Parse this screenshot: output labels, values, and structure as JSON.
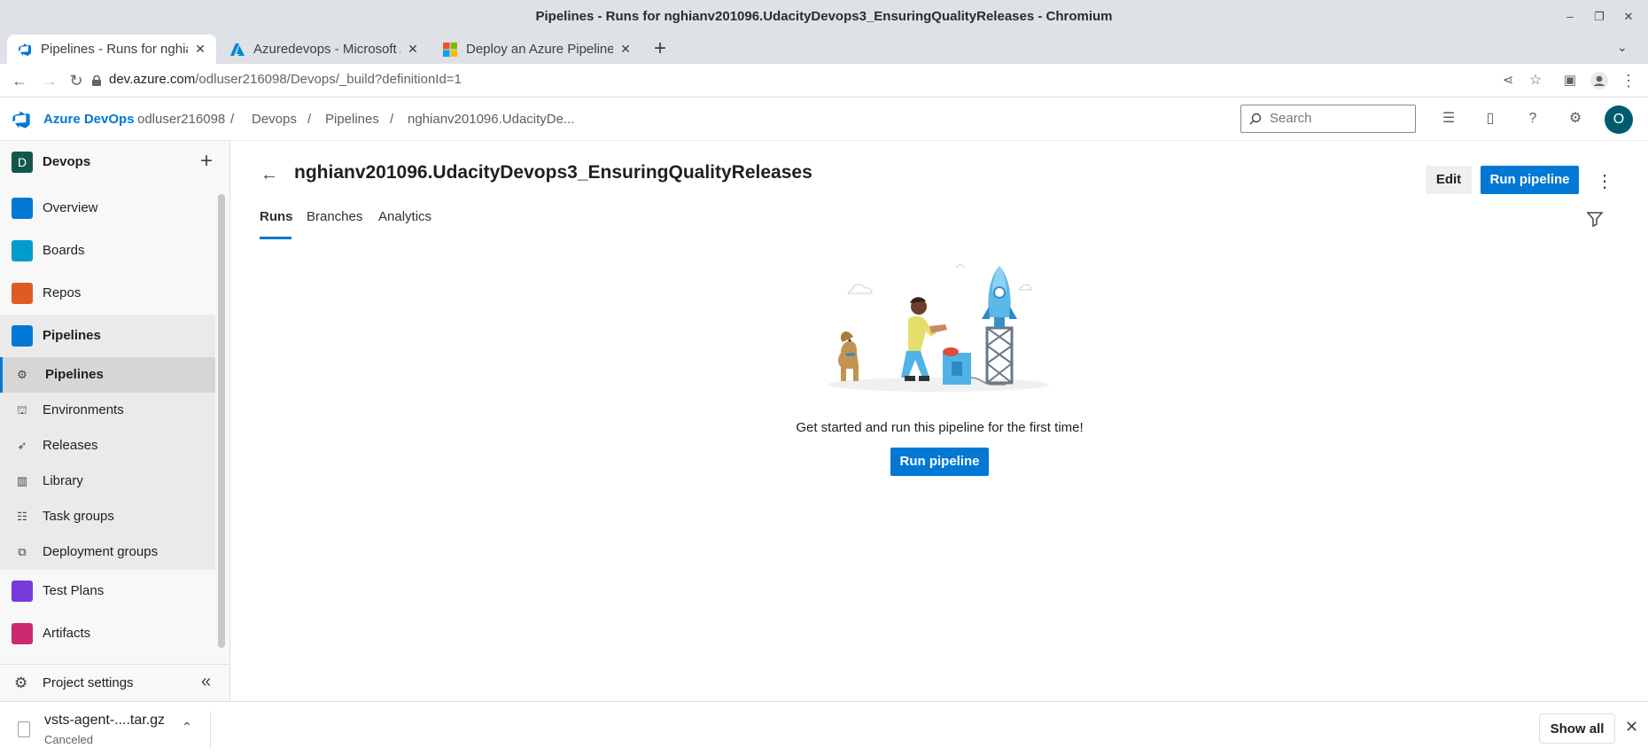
{
  "window": {
    "title": "Pipelines - Runs for nghianv201096.UdacityDevops3_EnsuringQualityReleases - Chromium"
  },
  "browser": {
    "tabs": [
      {
        "label": "Pipelines - Runs for nghia",
        "active": true,
        "icon": "azure-devops-icon"
      },
      {
        "label": "Azuredevops - Microsoft A",
        "active": false,
        "icon": "azure-icon"
      },
      {
        "label": "Deploy an Azure Pipelines",
        "active": false,
        "icon": "microsoft-icon"
      }
    ],
    "url_host": "dev.azure.com",
    "url_path": "/odluser216098/Devops/_build?definitionId=1"
  },
  "header": {
    "brand": "Azure DevOps",
    "breadcrumbs": [
      "odluser216098",
      "Devops",
      "Pipelines",
      "nghianv201096.UdacityDe..."
    ],
    "search_placeholder": "Search",
    "avatar_initial": "O"
  },
  "sidebar": {
    "project_initial": "D",
    "project_name": "Devops",
    "items": [
      {
        "label": "Overview",
        "icon": "overview-icon",
        "color": "#0078d4"
      },
      {
        "label": "Boards",
        "icon": "boards-icon",
        "color": "#009ccc"
      },
      {
        "label": "Repos",
        "icon": "repos-icon",
        "color": "#e05b24"
      },
      {
        "label": "Pipelines",
        "icon": "pipelines-icon",
        "color": "#0078d4"
      },
      {
        "label": "Test Plans",
        "icon": "test-plans-icon",
        "color": "#773adc"
      },
      {
        "label": "Artifacts",
        "icon": "artifacts-icon",
        "color": "#cc2a6e"
      }
    ],
    "sub_items": [
      {
        "label": "Pipelines",
        "icon": "pipeline-sub-icon"
      },
      {
        "label": "Environments",
        "icon": "environments-icon"
      },
      {
        "label": "Releases",
        "icon": "releases-icon"
      },
      {
        "label": "Library",
        "icon": "library-icon"
      },
      {
        "label": "Task groups",
        "icon": "task-groups-icon"
      },
      {
        "label": "Deployment groups",
        "icon": "deployment-groups-icon"
      }
    ],
    "settings_label": "Project settings"
  },
  "main": {
    "title": "nghianv201096.UdacityDevops3_EnsuringQualityReleases",
    "edit_label": "Edit",
    "run_pipeline_label": "Run pipeline",
    "tabs": [
      "Runs",
      "Branches",
      "Analytics"
    ],
    "active_tab": "Runs",
    "empty_message": "Get started and run this pipeline for the first time!",
    "empty_button": "Run pipeline"
  },
  "downloads": {
    "file_name": "vsts-agent-....tar.gz",
    "status": "Canceled",
    "show_all_label": "Show all"
  },
  "colors": {
    "accent": "#0078d4",
    "avatar": "#005b70",
    "project_badge": "#13574b"
  }
}
